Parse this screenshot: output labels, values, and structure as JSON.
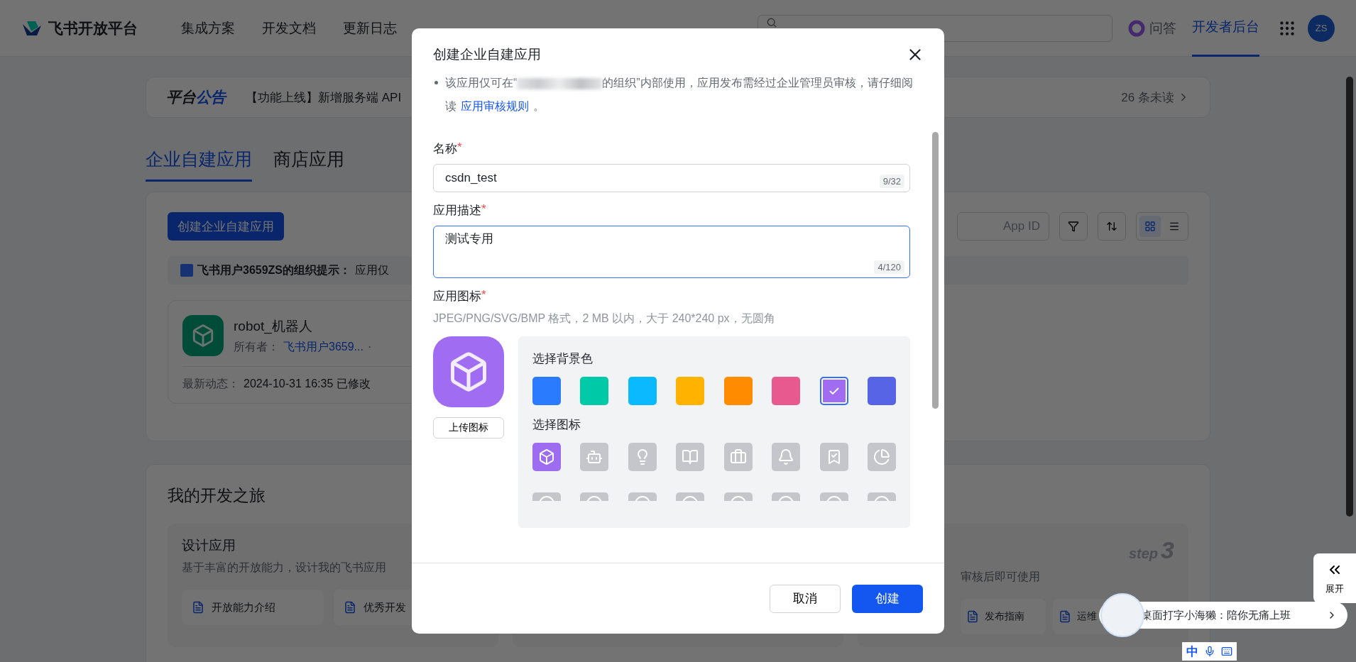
{
  "nav": {
    "logo": "飞书开放平台",
    "items": [
      {
        "label": "集成方案"
      },
      {
        "label": "开发文档"
      },
      {
        "label": "更新日志"
      }
    ],
    "qa": "问答",
    "console": {
      "label": "开发者后台",
      "selected": true
    },
    "avatar": "ZS"
  },
  "announcement": {
    "title_a": "平台",
    "title_b": "公告",
    "text": "【功能上线】新增服务端 API",
    "unread": "26 条未读"
  },
  "tabs": [
    {
      "label": "企业自建应用",
      "selected": true
    },
    {
      "label": "商店应用",
      "selected": false
    }
  ],
  "apps": {
    "create_button": "创建企业自建应用",
    "search_placeholder": "App ID",
    "views": [
      {
        "kind": "grid",
        "selected": true
      },
      {
        "kind": "list",
        "selected": false
      }
    ],
    "tip_org": "飞书用户3659ZS的组织提示：",
    "tip_text": "应用仅",
    "app": {
      "name": "robot_机器人",
      "owner_label": "所有者：",
      "owner": "飞书用户3659...",
      "dot": "·",
      "activity_label": "最新动态：",
      "activity": "2024-10-31 16:35 已修改"
    }
  },
  "journey": {
    "title": "我的开发之旅",
    "design": {
      "title": "设计应用",
      "desc": "基于丰富的开放能力，设计我的飞书应用",
      "links": [
        "开放能力介绍",
        "优秀开发"
      ]
    },
    "publish": {
      "step": "step",
      "step_no": "3",
      "desc": "审核后即可使用",
      "links": [
        "发布指南",
        "运维"
      ]
    }
  },
  "dialog": {
    "title": "创建企业自建应用",
    "notice_a": "该应用仅可在“",
    "notice_b": "的组织”内部使用，应用发布需经过企业管理员审核，请仔细阅读",
    "notice_link": "应用审核规则",
    "notice_end": "。",
    "required_mark": "*",
    "name_label": "名称",
    "name_value": "csdn_test",
    "name_count": "9/32",
    "desc_label": "应用描述",
    "desc_value": "测试专用",
    "desc_count": "4/120",
    "icon_label": "应用图标",
    "icon_hint": "JPEG/PNG/SVG/BMP 格式，2 MB 以内，大于 240*240 px，无圆角",
    "upload": "上传图标",
    "bg_label": "选择背景色",
    "colors": [
      {
        "color": "#2b7bff",
        "selected": false
      },
      {
        "color": "#00c9a7",
        "selected": false
      },
      {
        "color": "#0bb9ff",
        "selected": false
      },
      {
        "color": "#ffb300",
        "selected": false
      },
      {
        "color": "#ff8c00",
        "selected": false
      },
      {
        "color": "#e85a8f",
        "selected": false
      },
      {
        "color": "#a06cf2",
        "selected": true
      },
      {
        "color": "#5864e6",
        "selected": false
      }
    ],
    "icon_pick_label": "选择图标",
    "icons": [
      {
        "kind": "cube",
        "selected": true
      },
      {
        "kind": "robot",
        "selected": false
      },
      {
        "kind": "bulb",
        "selected": false
      },
      {
        "kind": "book",
        "selected": false
      },
      {
        "kind": "briefcase",
        "selected": false
      },
      {
        "kind": "bell",
        "selected": false
      },
      {
        "kind": "bookmark",
        "selected": false
      },
      {
        "kind": "pie",
        "selected": false
      },
      {
        "kind": "more",
        "selected": false
      },
      {
        "kind": "more",
        "selected": false
      },
      {
        "kind": "more",
        "selected": false
      },
      {
        "kind": "more",
        "selected": false
      },
      {
        "kind": "more",
        "selected": false
      },
      {
        "kind": "more",
        "selected": false
      },
      {
        "kind": "more",
        "selected": false
      },
      {
        "kind": "more",
        "selected": false
      }
    ],
    "cancel": "取消",
    "create": "创建"
  },
  "side_tab": "展开",
  "promo": "桌面打字小海獭：陪你无痛上班",
  "ime": "中"
}
